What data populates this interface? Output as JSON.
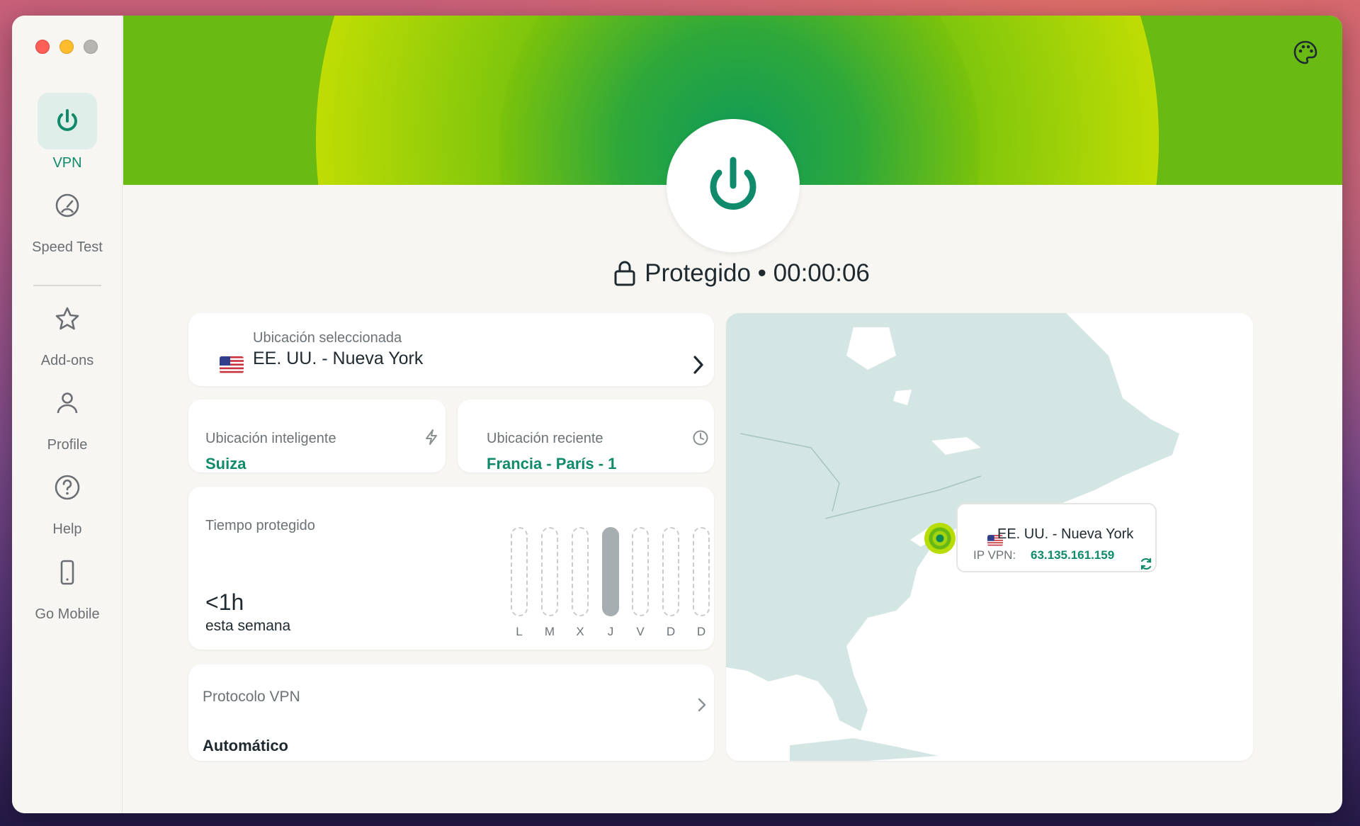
{
  "sidebar": {
    "items": [
      {
        "label": "VPN",
        "icon": "power-icon",
        "active": true
      },
      {
        "label": "Speed Test",
        "icon": "speedometer-icon"
      },
      {
        "label": "Add-ons",
        "icon": "star-icon"
      },
      {
        "label": "Profile",
        "icon": "user-icon"
      },
      {
        "label": "Help",
        "icon": "help-circle-icon"
      },
      {
        "label": "Go Mobile",
        "icon": "mobile-icon"
      }
    ]
  },
  "header": {
    "palette_icon": "palette-icon"
  },
  "status": {
    "text": "Protegido • 00:00:06",
    "icon": "lock-icon"
  },
  "selected_location": {
    "label": "Ubicación seleccionada",
    "value": "EE. UU. - Nueva York",
    "flag": "us-flag"
  },
  "smart_location": {
    "label": "Ubicación inteligente",
    "value": "Suiza",
    "icon": "bolt-icon"
  },
  "recent_location": {
    "label": "Ubicación reciente",
    "value": "Francia - París - 1",
    "icon": "clock-icon"
  },
  "protected_time": {
    "label": "Tiempo protegido",
    "value": "<1h",
    "subtitle": "esta semana",
    "days": [
      "L",
      "M",
      "X",
      "J",
      "V",
      "D",
      "D"
    ],
    "active_day_index": 3
  },
  "protocol": {
    "label": "Protocolo VPN",
    "value": "Automático"
  },
  "map": {
    "tooltip_name": "EE. UU. - Nueva York",
    "ip_label": "IP VPN:",
    "ip_value": "63.135.161.159",
    "refresh_icon": "refresh-icon"
  },
  "colors": {
    "accent": "#0f8a6a",
    "hero_green": "#69bb13",
    "map_land": "#d3e6e4"
  }
}
